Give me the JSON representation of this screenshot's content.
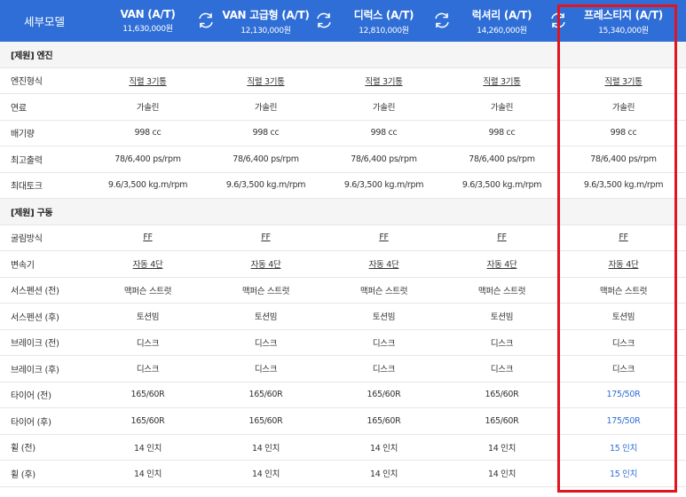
{
  "header": {
    "spec_label": "세부모델",
    "trims": [
      {
        "name": "VAN (A/T)",
        "price": "11,630,000원"
      },
      {
        "name": "VAN 고급형 (A/T)",
        "price": "12,130,000원"
      },
      {
        "name": "디럭스 (A/T)",
        "price": "12,810,000원"
      },
      {
        "name": "럭셔리 (A/T)",
        "price": "14,260,000원"
      },
      {
        "name": "프레스티지 (A/T)",
        "price": "15,340,000원"
      }
    ]
  },
  "sections": [
    {
      "title": "[제원] 엔진",
      "rows": [
        {
          "label": "엔진형식",
          "values": [
            "직렬 3기통",
            "직렬 3기통",
            "직렬 3기통",
            "직렬 3기통",
            "직렬 3기통"
          ]
        },
        {
          "label": "연료",
          "values": [
            "가솔린",
            "가솔린",
            "가솔린",
            "가솔린",
            "가솔린"
          ]
        },
        {
          "label": "배기량",
          "values": [
            "998 cc",
            "998 cc",
            "998 cc",
            "998 cc",
            "998 cc"
          ]
        },
        {
          "label": "최고출력",
          "values": [
            "78/6,400 ps/rpm",
            "78/6,400 ps/rpm",
            "78/6,400 ps/rpm",
            "78/6,400 ps/rpm",
            "78/6,400 ps/rpm"
          ]
        },
        {
          "label": "최대토크",
          "values": [
            "9.6/3,500 kg.m/rpm",
            "9.6/3,500 kg.m/rpm",
            "9.6/3,500 kg.m/rpm",
            "9.6/3,500 kg.m/rpm",
            "9.6/3,500 kg.m/rpm"
          ]
        }
      ]
    },
    {
      "title": "[제원] 구동",
      "rows": [
        {
          "label": "굴림방식",
          "values": [
            "FF",
            "FF",
            "FF",
            "FF",
            "FF"
          ]
        },
        {
          "label": "변속기",
          "values": [
            "자동 4단",
            "자동 4단",
            "자동 4단",
            "자동 4단",
            "자동 4단"
          ]
        },
        {
          "label": "서스펜션 (전)",
          "values": [
            "맥퍼슨 스트럿",
            "맥퍼슨 스트럿",
            "맥퍼슨 스트럿",
            "맥퍼슨 스트럿",
            "맥퍼슨 스트럿"
          ]
        },
        {
          "label": "서스펜션 (후)",
          "values": [
            "토션빔",
            "토션빔",
            "토션빔",
            "토션빔",
            "토션빔"
          ]
        },
        {
          "label": "브레이크 (전)",
          "values": [
            "디스크",
            "디스크",
            "디스크",
            "디스크",
            "디스크"
          ]
        },
        {
          "label": "브레이크 (후)",
          "values": [
            "디스크",
            "디스크",
            "디스크",
            "디스크",
            "디스크"
          ]
        },
        {
          "label": "타이어 (전)",
          "values": [
            "165/60R",
            "165/60R",
            "165/60R",
            "165/60R",
            "175/50R"
          ]
        },
        {
          "label": "타이어 (후)",
          "values": [
            "165/60R",
            "165/60R",
            "165/60R",
            "165/60R",
            "175/50R"
          ]
        },
        {
          "label": "휠 (전)",
          "values": [
            "14 인치",
            "14 인치",
            "14 인치",
            "14 인치",
            "15 인치"
          ]
        },
        {
          "label": "휠 (후)",
          "values": [
            "14 인치",
            "14 인치",
            "14 인치",
            "14 인치",
            "15 인치"
          ]
        }
      ]
    }
  ],
  "colors": {
    "header_bg": "#2f6ed6",
    "highlight_text": "#2f6ed6",
    "selection_frame": "#e1141f"
  },
  "icons": {
    "compare_swap": "swap-arrows-icon"
  }
}
